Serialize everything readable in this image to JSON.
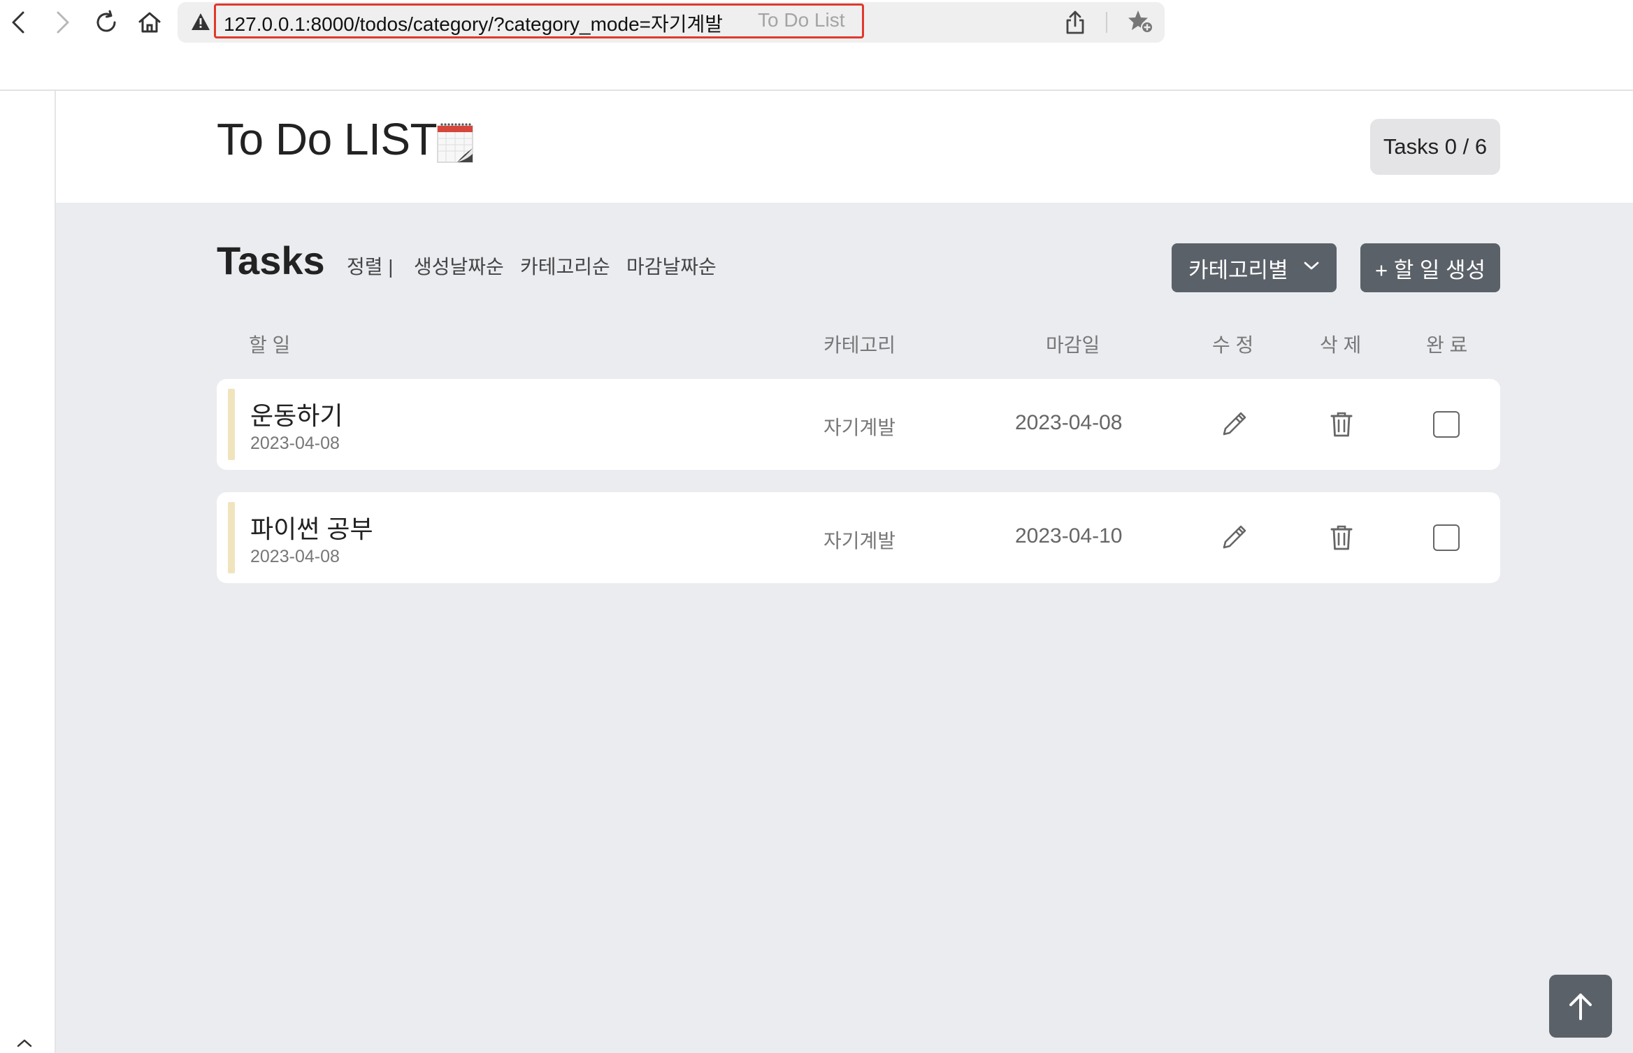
{
  "browser": {
    "url": "127.0.0.1:8000/todos/category/?category_mode=자기계발",
    "page_title": "To Do List"
  },
  "header": {
    "title": "To Do LIST",
    "title_icon": "calendar-icon",
    "tasks_counter": "Tasks 0 / 6"
  },
  "tasks_section": {
    "title": "Tasks",
    "sort_label": "정렬 |",
    "sort_options": [
      "생성날짜순",
      "카테고리순",
      "마감날짜순"
    ],
    "category_dropdown": "카테고리별",
    "add_button": "+ 할 일 생성"
  },
  "columns": [
    "할 일",
    "카테고리",
    "마감일",
    "수 정",
    "삭 제",
    "완 료"
  ],
  "tasks": [
    {
      "name": "운동하기",
      "created": "2023-04-08",
      "category": "자기계발",
      "due": "2023-04-08",
      "done": false
    },
    {
      "name": "파이썬 공부",
      "created": "2023-04-08",
      "category": "자기계발",
      "due": "2023-04-10",
      "done": false
    }
  ],
  "colors": {
    "button_bg": "#5b6169",
    "main_bg": "#ebecf0",
    "row_accent": "#efe4bd",
    "url_highlight": "#e0392b"
  }
}
